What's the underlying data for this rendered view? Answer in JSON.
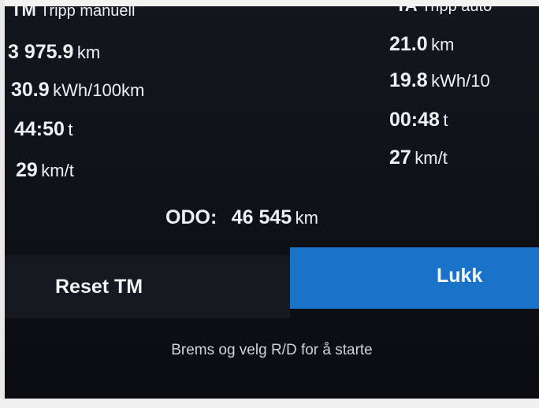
{
  "trip_manual": {
    "header_abbr": "TM",
    "header_label": "Tripp manuell",
    "distance_value": "3 975.9",
    "distance_unit": "km",
    "consumption_value": "30.9",
    "consumption_unit": "kWh/100km",
    "time_value": "44:50",
    "time_unit": "t",
    "speed_value": "29",
    "speed_unit": "km/t"
  },
  "trip_auto": {
    "header_abbr": "TA",
    "header_label": "Tripp auto",
    "distance_value": "21.0",
    "distance_unit": "km",
    "consumption_value": "19.8",
    "consumption_unit": "kWh/10",
    "time_value": "00:48",
    "time_unit": "t",
    "speed_value": "27",
    "speed_unit": "km/t"
  },
  "odometer": {
    "label": "ODO:",
    "value": "46 545",
    "unit": "km"
  },
  "buttons": {
    "reset_label": "Reset TM",
    "close_label": "Lukk"
  },
  "hint_text": "Brems og velg R/D for å starte",
  "colors": {
    "accent": "#1a73c8",
    "background": "#0f1318"
  }
}
